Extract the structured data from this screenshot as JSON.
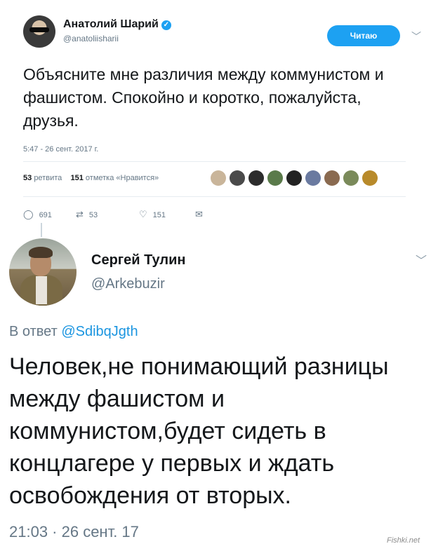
{
  "tweet1": {
    "author_name": "Анатолий Шарий",
    "handle": "@anatoliisharii",
    "follow_label": "Читаю",
    "text": "Объясните мне различия между коммунистом и фашистом. Спокойно и коротко, пожалуйста, друзья.",
    "timestamp": "5:47 - 26 сент. 2017 г.",
    "retweets_count": "53",
    "retweets_label": "ретвита",
    "likes_count": "151",
    "likes_label": "отметка «Нравится»",
    "actions": {
      "replies": "691",
      "retweets": "53",
      "likes": "151"
    },
    "icons": [
      "reply-icon",
      "retweet-icon",
      "like-icon",
      "message-icon",
      "verified-icon",
      "chevron-down-icon"
    ]
  },
  "tweet2": {
    "author_name": "Сергей Тулин",
    "handle": "@Arkebuzir",
    "reply_prefix": "В ответ",
    "reply_mention": "@SdibqJgth",
    "text": "Человек,не понимающий разницы между фашистом и коммунистом,будет сидеть в концлагере у первых и ждать освобождения от вторых.",
    "timestamp": "21:03 · 26 сент. 17"
  },
  "colors": {
    "accent": "#1da1f2",
    "mention": "#1b95e0",
    "secondary_text": "#657786"
  },
  "watermark": "Fishki.net"
}
